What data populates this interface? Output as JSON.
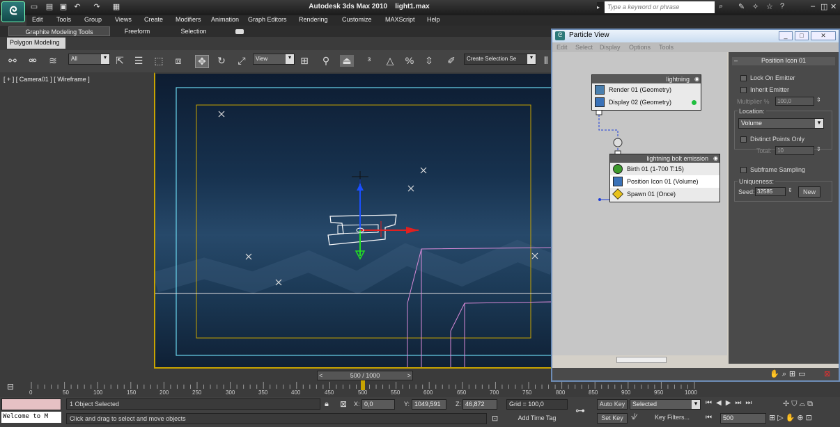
{
  "app": {
    "title": "Autodesk 3ds Max  2010",
    "file": "light1.max",
    "logo": "3ds-max-logo",
    "search_placeholder": "Type a keyword or phrase"
  },
  "menus": [
    "Edit",
    "Tools",
    "Group",
    "Views",
    "Create",
    "Modifiers",
    "Animation",
    "Graph Editors",
    "Rendering",
    "Customize",
    "MAXScript",
    "Help"
  ],
  "ribbon": {
    "tabs": [
      "Graphite Modeling Tools",
      "Freeform",
      "Selection"
    ],
    "subtab": "Polygon Modeling"
  },
  "toolbar": {
    "filter": "All",
    "ref_coord": "View",
    "selection_set": "Create Selection Se"
  },
  "viewport": {
    "label": "[ + ] [ Camera01 ] [ Wireframe ]"
  },
  "timeslider": {
    "label": "500 / 1000",
    "prev": "<",
    "next": ">"
  },
  "trackbar": {
    "ticks": [
      "0",
      "50",
      "100",
      "150",
      "200",
      "250",
      "300",
      "350",
      "400",
      "450",
      "500",
      "550",
      "600",
      "650",
      "700",
      "750",
      "800",
      "850",
      "900",
      "950",
      "1000"
    ]
  },
  "status": {
    "selection": "1 Object Selected",
    "prompt": "Click and drag to select and move objects",
    "welcome": "Welcome to M",
    "x_label": "X:",
    "x": "0,0",
    "y_label": "Y:",
    "y": "1049,591",
    "z_label": "Z:",
    "z": "46,872",
    "grid": "Grid = 100,0",
    "add_time_tag": "Add Time Tag",
    "auto_key": "Auto Key",
    "set_key": "Set Key",
    "key_mode": "Selected",
    "key_filters": "Key Filters...",
    "frame": "500"
  },
  "particle_view": {
    "title": "Particle View",
    "menus": [
      "Edit",
      "Select",
      "Display",
      "Options",
      "Tools"
    ],
    "node1": {
      "name": "lightning",
      "ops": [
        "Render 01 (Geometry)",
        "Display 02 (Geometry)"
      ]
    },
    "node2": {
      "name": "lightning bolt emission",
      "ops": [
        "Birth 01 (1-700 T:15)",
        "Position Icon 01 (Volume)",
        "Spawn 01 (Once)"
      ]
    },
    "params": {
      "rollout": "Position Icon 01",
      "lock_on_emitter": "Lock On Emitter",
      "inherit_emitter": "Inherit Emitter",
      "multiplier_label": "Multiplier %",
      "multiplier": "100,0",
      "location_label": "Location:",
      "location": "Volume",
      "distinct_points": "Distinct Points Only",
      "total_label": "Total:",
      "total": "10",
      "subframe": "Subframe Sampling",
      "uniqueness_label": "Uniqueness:",
      "seed_label": "Seed:",
      "seed": "32585",
      "new_button": "New"
    }
  }
}
